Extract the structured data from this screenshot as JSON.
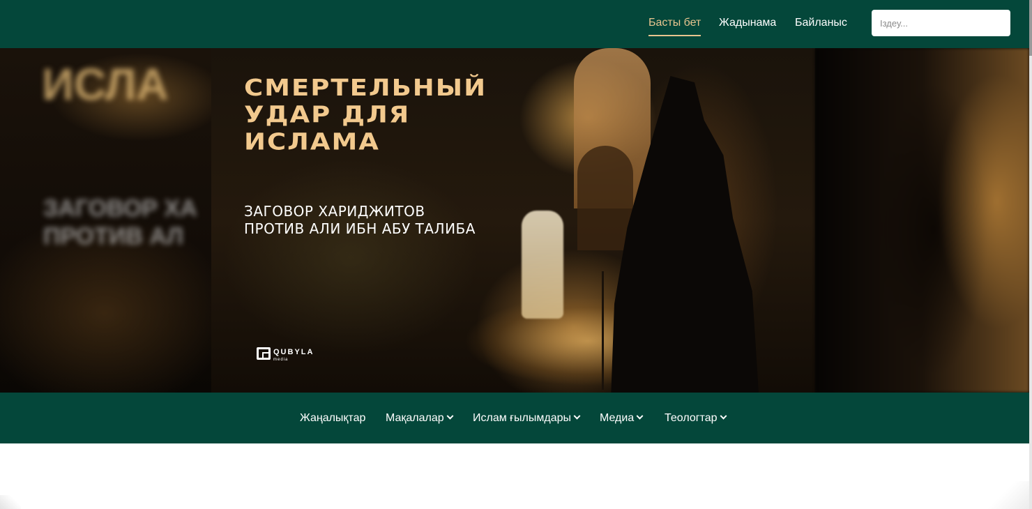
{
  "header": {
    "nav": [
      {
        "label": "Басты бет",
        "active": true
      },
      {
        "label": "Жадынама",
        "active": false
      },
      {
        "label": "Байланыс",
        "active": false
      }
    ],
    "search": {
      "placeholder": "Іздеу..."
    }
  },
  "hero": {
    "title": "СМЕРТЕЛЬНЫЙ\nУДАР ДЛЯ\nИСЛАМА",
    "subtitle": "ЗАГОВОР ХАРИДЖИТОВ\nПРОТИВ АЛИ ИБН АБУ ТАЛИБА",
    "logo_text": "QUBYLA",
    "logo_sub": "media",
    "blur_title": "ИСЛА",
    "blur_subtitle": "ЗАГОВОР ХА\nПРОТИВ АЛ"
  },
  "category_nav": [
    {
      "label": "Жаңалықтар",
      "dropdown": false
    },
    {
      "label": "Мақалалар",
      "dropdown": true
    },
    {
      "label": "Ислам ғылымдары",
      "dropdown": true
    },
    {
      "label": "Медиа",
      "dropdown": true
    },
    {
      "label": "Теологтар",
      "dropdown": true
    }
  ],
  "colors": {
    "brand_green": "#04473a",
    "accent_gold": "#e8c58f"
  }
}
